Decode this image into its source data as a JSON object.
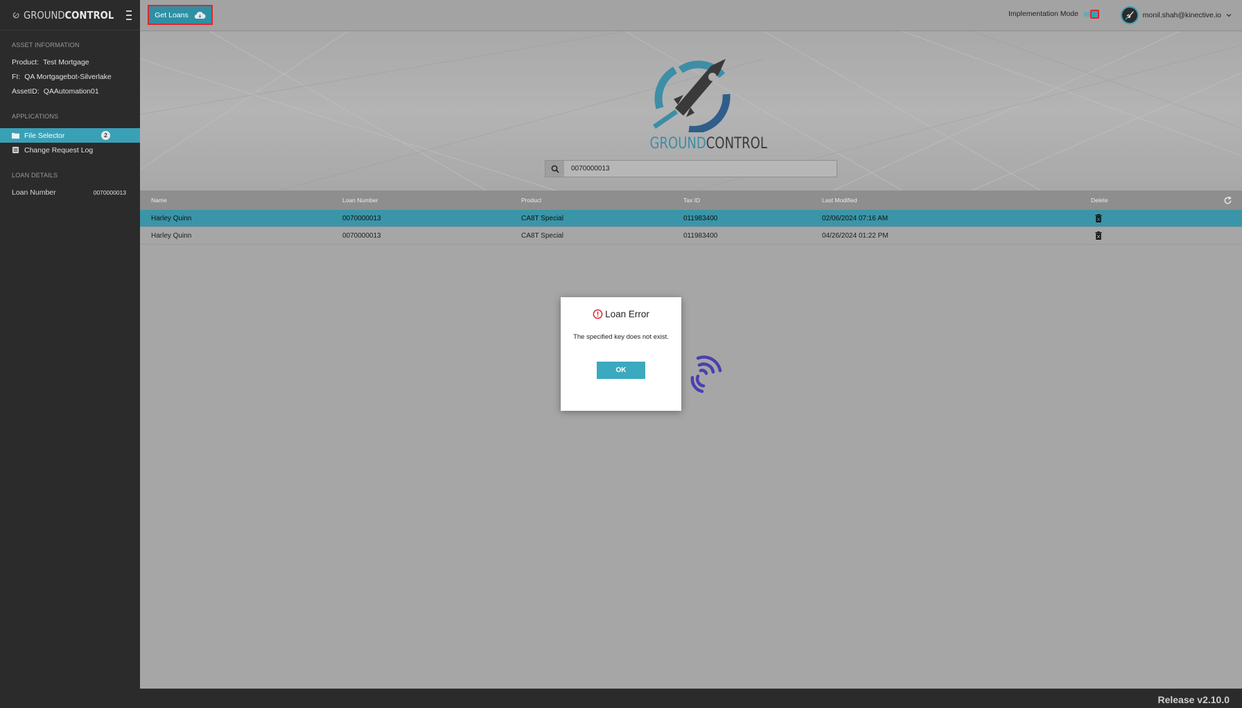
{
  "app": {
    "brand_light": "GROUND",
    "brand_bold": "CONTROL"
  },
  "sidebar": {
    "asset_section": "ASSET INFORMATION",
    "asset": [
      {
        "key": "Product:",
        "value": "Test Mortgage"
      },
      {
        "key": "FI:",
        "value": "QA Mortgagebot-Silverlake"
      },
      {
        "key": "AssetID:",
        "value": "QAAutomation01"
      }
    ],
    "applications_section": "APPLICATIONS",
    "items": [
      {
        "label": "File Selector",
        "badge": "2",
        "icon": "folder-icon",
        "active": true
      },
      {
        "label": "Change Request Log",
        "icon": "log-icon",
        "active": false
      }
    ],
    "loan_section": "LOAN DETAILS",
    "loan_number_label": "Loan Number",
    "loan_number_value": "0070000013"
  },
  "topbar": {
    "get_loans_label": "Get Loans",
    "implementation_mode_label": "Implementation Mode",
    "user_email": "monil.shah@kinective.io"
  },
  "hero": {
    "logo_text_light": "GROUND",
    "logo_text_bold": "CONTROL",
    "search_value": "0070000013"
  },
  "table": {
    "headers": [
      "Name",
      "Loan Number",
      "Product",
      "Tax ID",
      "Last Modified",
      "Delete"
    ],
    "rows": [
      {
        "name": "Harley Quinn",
        "loan_number": "0070000013",
        "product": "CA8T Special",
        "tax_id": "011983400",
        "last_modified": "02/06/2024 07:16 AM",
        "selected": true
      },
      {
        "name": "Harley Quinn",
        "loan_number": "0070000013",
        "product": "CA8T Special",
        "tax_id": "011983400",
        "last_modified": "04/26/2024 01:22 PM",
        "selected": false
      }
    ]
  },
  "modal": {
    "title": "Loan Error",
    "message": "The specified key does not exist.",
    "ok_label": "OK"
  },
  "footer": {
    "release": "Release v2.10.0"
  },
  "colors": {
    "accent": "#3aa0b6",
    "error": "#e0262e",
    "sidebar": "#2b2b2b"
  }
}
